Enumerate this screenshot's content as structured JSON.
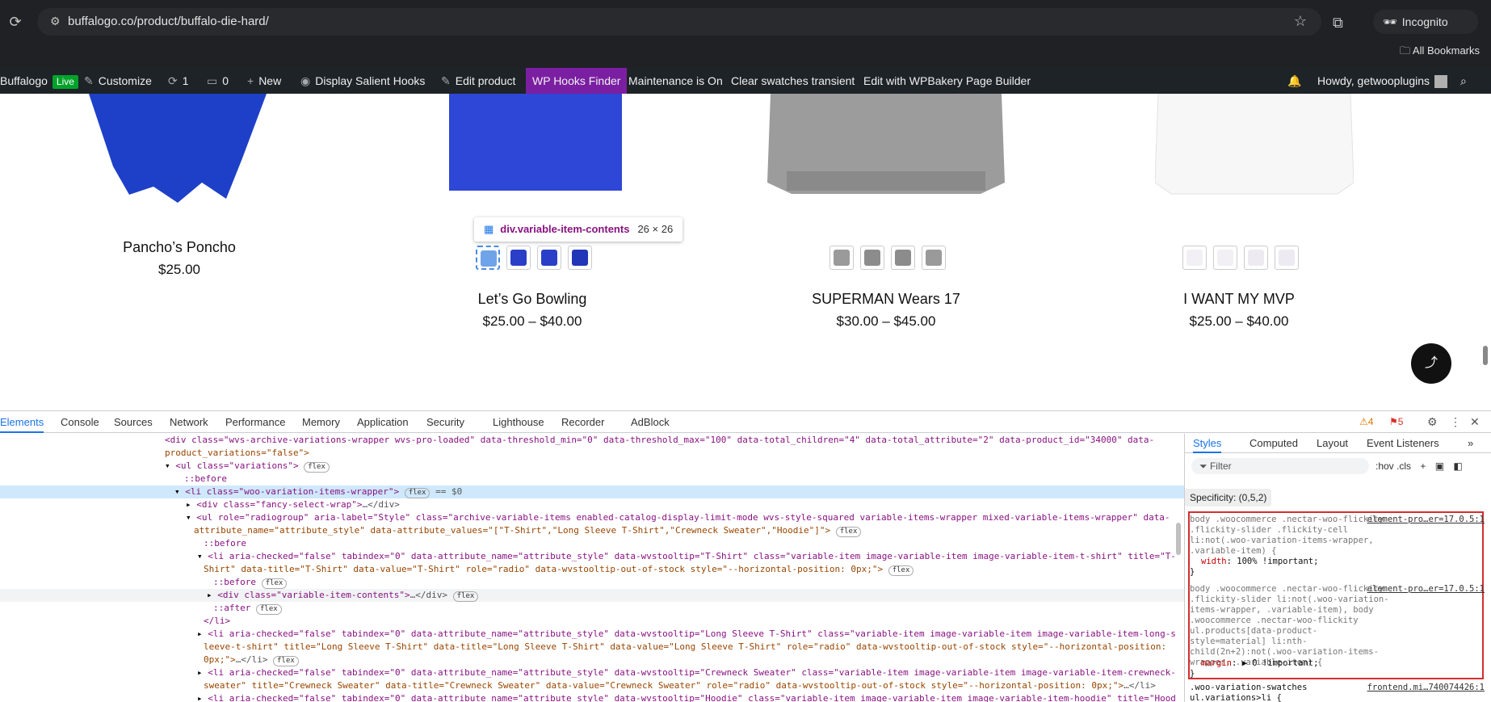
{
  "browser": {
    "url": "buffalogo.co/product/buffalo-die-hard/",
    "profile": "Incognito",
    "bookmarks_label": "All Bookmarks"
  },
  "adminbar": {
    "site": "Buffalogo",
    "live": "Live",
    "customize": "Customize",
    "updates": "1",
    "comments": "0",
    "new": "New",
    "display_hooks": "Display Salient Hooks",
    "edit_product": "Edit product",
    "hooks_finder": "WP Hooks Finder",
    "maintenance": "Maintenance is On",
    "clear_swatches": "Clear swatches transient",
    "wpbakery": "Edit with WPBakery Page Builder",
    "howdy": "Howdy, getwooplugins"
  },
  "products": [
    {
      "name": "Pancho’s Poncho",
      "price": "$25.00"
    },
    {
      "name": "Let’s Go Bowling",
      "price": "$25.00 – $40.00"
    },
    {
      "name": "SUPERMAN Wears 17",
      "price": "$30.00 – $45.00"
    },
    {
      "name": "I WANT MY MVP",
      "price": "$25.00 – $40.00"
    }
  ],
  "tooltip": {
    "tag": "div.variable-item-contents",
    "dims": "26 × 26"
  },
  "devtools": {
    "tabs": [
      "Elements",
      "Console",
      "Sources",
      "Network",
      "Performance",
      "Memory",
      "Application",
      "Security",
      "Lighthouse",
      "Recorder",
      "AdBlock"
    ],
    "warnings": "4",
    "issues": "5",
    "code": [
      "<div class=\"wvs-archive-variations-wrapper wvs-pro-loaded\" data-threshold_min=\"0\" data-threshold_max=\"100\" data-total_children=\"4\" data-total_attribute=\"2\" data-product_id=\"34000\" data-",
      "product_variations=\"false\">",
      "<ul class=\"variations\">",
      "::before",
      "<li class=\"woo-variation-items-wrapper\">",
      "<div class=\"fancy-select-wrap\">",
      "<ul role=\"radiogroup\" aria-label=\"Style\" class=\"archive-variable-items enabled-catalog-display-limit-mode wvs-style-squared variable-items-wrapper mixed-variable-items-wrapper\" data-",
      "attribute_name=\"attribute_style\" data-attribute_values=\"[\"T-Shirt\",\"Long Sleeve T-Shirt\",\"Crewneck Sweater\",\"Hoodie\"]\">",
      "::before",
      "<li aria-checked=\"false\" tabindex=\"0\" data-attribute_name=\"attribute_style\" data-wvstooltip=\"T-Shirt\" class=\"variable-item image-variable-item image-variable-item-t-shirt\" title=\"T-",
      "Shirt\" data-title=\"T-Shirt\" data-value=\"T-Shirt\" role=\"radio\" data-wvstooltip-out-of-stock style=\"--horizontal-position: 0px;\">",
      "::before",
      "<div class=\"variable-item-contents\">",
      "::after",
      "</li>",
      "<li aria-checked=\"false\" tabindex=\"0\" data-attribute_name=\"attribute_style\" data-wvstooltip=\"Long Sleeve T-Shirt\" class=\"variable-item image-variable-item image-variable-item-long-s",
      "leeve-t-shirt\" title=\"Long Sleeve T-Shirt\" data-title=\"Long Sleeve T-Shirt\" data-value=\"Long Sleeve T-Shirt\" role=\"radio\" data-wvstooltip-out-of-stock style=\"--horizontal-position:",
      "0px;\">",
      "<li aria-checked=\"false\" tabindex=\"0\" data-attribute_name=\"attribute_style\" data-wvstooltip=\"Crewneck Sweater\" class=\"variable-item image-variable-item image-variable-item-crewneck-",
      "sweater\" title=\"Crewneck Sweater\" data-title=\"Crewneck Sweater\" data-value=\"Crewneck Sweater\" role=\"radio\" data-wvstooltip-out-of-stock style=\"--horizontal-position: 0px;\">",
      "<li aria-checked=\"false\" tabindex=\"0\" data-attribute_name=\"attribute_style\" data-wvstooltip=\"Hoodie\" class=\"variable-item image-variable-item image-variable-item-hoodie\" title=\"Hood"
    ],
    "styles_tabs": [
      "Styles",
      "Computed",
      "Layout",
      "Event Listeners"
    ],
    "filter_placeholder": "Filter",
    "tools": ":hov  .cls",
    "specificity": "Specificity: (0,5,2)",
    "rule1": {
      "selector": "body .woocommerce .nectar-woo-flickity .flickity-slider .flickity-cell li:not(.woo-variation-items-wrapper, .variable-item) {",
      "source": "element-pro…er=17.0.5:1",
      "prop": "width",
      "value": "100% !important;"
    },
    "rule2": {
      "selector": "body .woocommerce .nectar-woo-flickity .flickity-slider li:not(.woo-variation-items-wrapper, .variable-item), body .woocommerce .nectar-woo-flickity ul.products[data-product-style=material] li:nth-child(2n+2):not(.woo-variation-items-wrapper, .variable-item) {",
      "source": "element-pro…er=17.0.5:1",
      "prop": "margin",
      "value": "▶ 0 !important;"
    },
    "rule3": {
      "selector": ".woo-variation-swatches ul.variations>li {",
      "source": "frontend.mi…740074426:1"
    }
  }
}
